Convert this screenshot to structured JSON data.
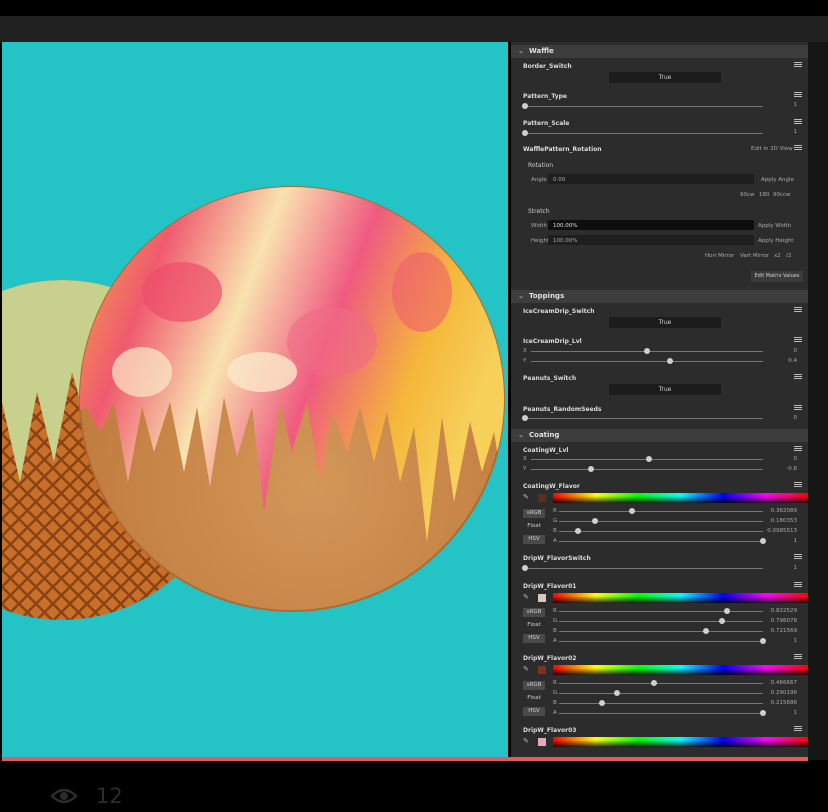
{
  "footer": {
    "view_count": "12"
  },
  "sections": {
    "waffle": "Waffle",
    "toppings": "Toppings",
    "coating": "Coating"
  },
  "waffle": {
    "border_switch": {
      "label": "Border_Switch",
      "value": "True"
    },
    "pattern_type": {
      "label": "Pattern_Type",
      "value": "1"
    },
    "pattern_scale": {
      "label": "Pattern_Scale",
      "value": "1"
    },
    "pattern_rotation": {
      "label": "WafflePattern_Rotation",
      "edit_2d": "Edit in 2D View",
      "rotation_label": "Rotation",
      "angle_label": "Angle",
      "angle_value": "0.00",
      "apply_angle": "Apply Angle",
      "presets": [
        "90cw",
        "180",
        "90ccw"
      ],
      "stretch_label": "Stretch",
      "width_label": "Width",
      "width_value": "100.00%",
      "apply_width": "Apply Width",
      "height_label": "Height",
      "height_value": "100.00%",
      "apply_height": "Apply Height",
      "hor_mirror": "Hori Mirror",
      "vert_mirror": "Vert Mirror",
      "x2": "x2",
      "half": "/2",
      "edit_matrix": "Edit Matrix Values"
    }
  },
  "toppings": {
    "icecream_switch": {
      "label": "IceCreamDrip_Switch",
      "value": "True"
    },
    "icecream_lvl": {
      "label": "IceCreamDrip_Lvl",
      "x_label": "X",
      "x_value": "0",
      "x_pos": 0.5,
      "y_label": "Y",
      "y_value": "0.4",
      "y_pos": 0.6
    },
    "peanuts_switch": {
      "label": "Peanuts_Switch",
      "value": "True"
    },
    "peanuts_seeds": {
      "label": "Peanuts_RandomSeeds",
      "value": "0"
    }
  },
  "coating": {
    "coatingw_lvl": {
      "label": "CoatingW_Lvl",
      "x_label": "X",
      "x_value": "0",
      "x_pos": 0.5,
      "y_label": "Y",
      "y_value": "-0.8",
      "y_pos": 0.28
    },
    "coatingw_flavor": {
      "label": "CoatingW_Flavor",
      "swatch": "#5c3119",
      "modes": [
        "sRGB",
        "Float",
        "HSV"
      ],
      "channels": [
        {
          "label": "R",
          "value": "0.362089",
          "pos": 0.36
        },
        {
          "label": "G",
          "value": "0.180353",
          "pos": 0.18
        },
        {
          "label": "B",
          "value": "0.0985513",
          "pos": 0.1
        },
        {
          "label": "A",
          "value": "1",
          "pos": 1.0
        }
      ]
    },
    "dripw_switch": {
      "label": "DripW_FlavorSwitch",
      "value": "1"
    },
    "dripw_flavor01": {
      "label": "DripW_Flavor01",
      "swatch": "#d3c9b8",
      "modes": [
        "sRGB",
        "Float",
        "HSV"
      ],
      "channels": [
        {
          "label": "R",
          "value": "0.822529",
          "pos": 0.82
        },
        {
          "label": "G",
          "value": "0.796078",
          "pos": 0.8
        },
        {
          "label": "B",
          "value": "0.721569",
          "pos": 0.72
        },
        {
          "label": "A",
          "value": "1",
          "pos": 1.0
        }
      ]
    },
    "dripw_flavor02": {
      "label": "DripW_Flavor02",
      "swatch": "#7a3422",
      "modes": [
        "sRGB",
        "Float",
        "HSV"
      ],
      "channels": [
        {
          "label": "R",
          "value": "0.466667",
          "pos": 0.47
        },
        {
          "label": "G",
          "value": "0.290196",
          "pos": 0.29
        },
        {
          "label": "B",
          "value": "0.215686",
          "pos": 0.21
        },
        {
          "label": "A",
          "value": "1",
          "pos": 1.0
        }
      ]
    },
    "dripw_flavor03": {
      "label": "DripW_Flavor03",
      "swatch": "#e6a7c0"
    }
  }
}
